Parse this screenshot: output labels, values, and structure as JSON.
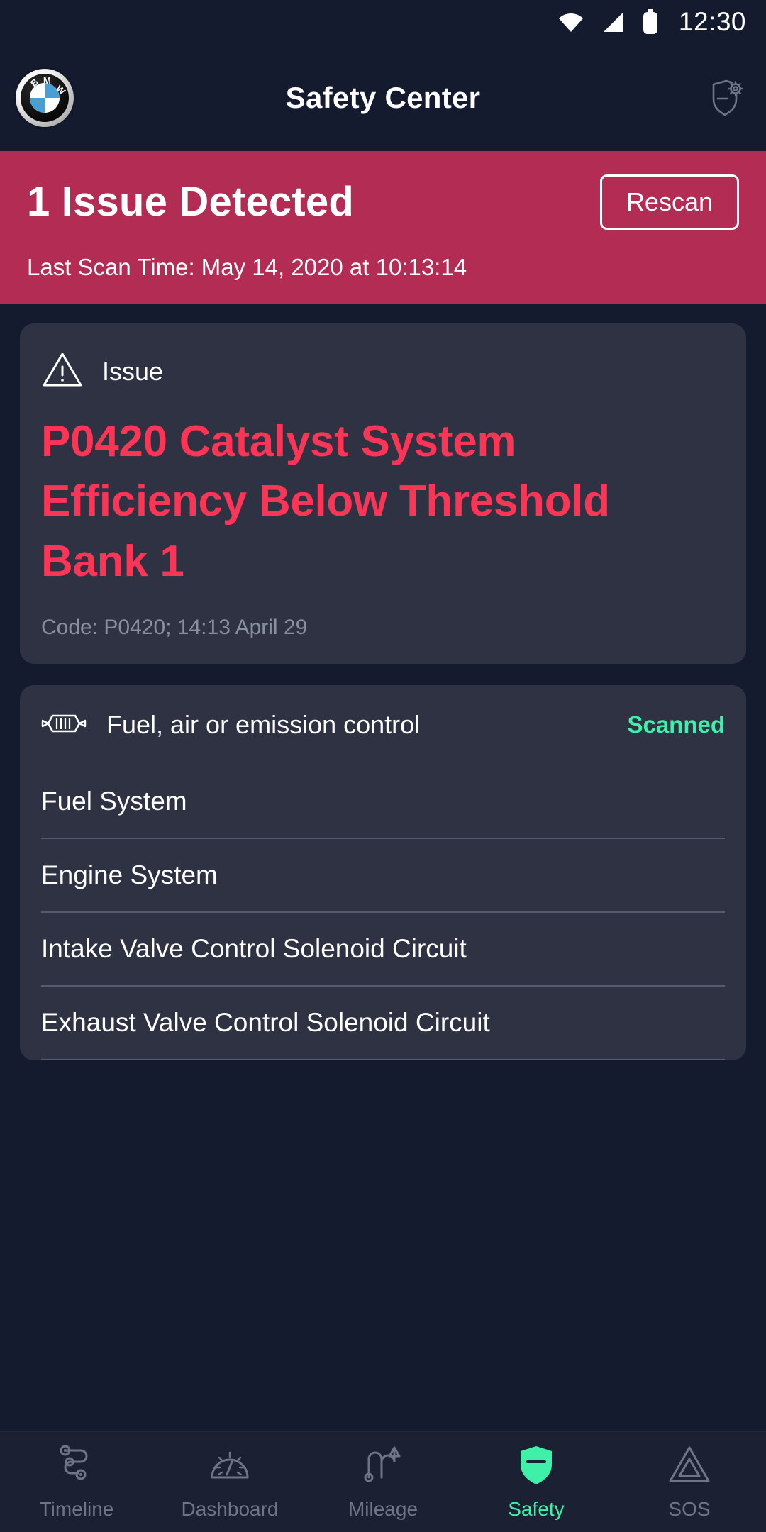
{
  "status_bar": {
    "time": "12:30",
    "icons": [
      "wifi-icon",
      "cellular-signal-icon",
      "battery-icon"
    ]
  },
  "app_bar": {
    "logo": "bmw-logo",
    "title": "Safety Center",
    "action_icon": "shield-settings-icon"
  },
  "banner": {
    "title": "1 Issue Detected",
    "rescan_label": "Rescan",
    "last_scan": "Last Scan Time: May 14, 2020 at 10:13:14",
    "background_color": "#b32c54"
  },
  "issue_card": {
    "icon": "warning-triangle-icon",
    "label": "Issue",
    "title": "P0420 Catalyst System Efficiency Below Threshold Bank 1",
    "code": "Code: P0420; 14:13 April 29",
    "title_color": "#fa3556"
  },
  "system_card": {
    "icon": "catalytic-converter-icon",
    "title": "Fuel, air or emission control",
    "status": "Scanned",
    "status_color": "#3ff0a8",
    "items": [
      "Fuel System",
      "Engine System",
      "Intake Valve Control Solenoid Circuit",
      "Exhaust Valve Control Solenoid Circuit"
    ]
  },
  "bottom_nav": {
    "active_color": "#3ff0a8",
    "inactive_color": "#6f7587",
    "items": [
      {
        "label": "Timeline",
        "icon": "route-icon",
        "active": false
      },
      {
        "label": "Dashboard",
        "icon": "gauge-icon",
        "active": false
      },
      {
        "label": "Mileage",
        "icon": "uturn-arrow-icon",
        "active": false
      },
      {
        "label": "Safety",
        "icon": "shield-icon",
        "active": true
      },
      {
        "label": "SOS",
        "icon": "warning-triangle-icon",
        "active": false
      }
    ]
  }
}
